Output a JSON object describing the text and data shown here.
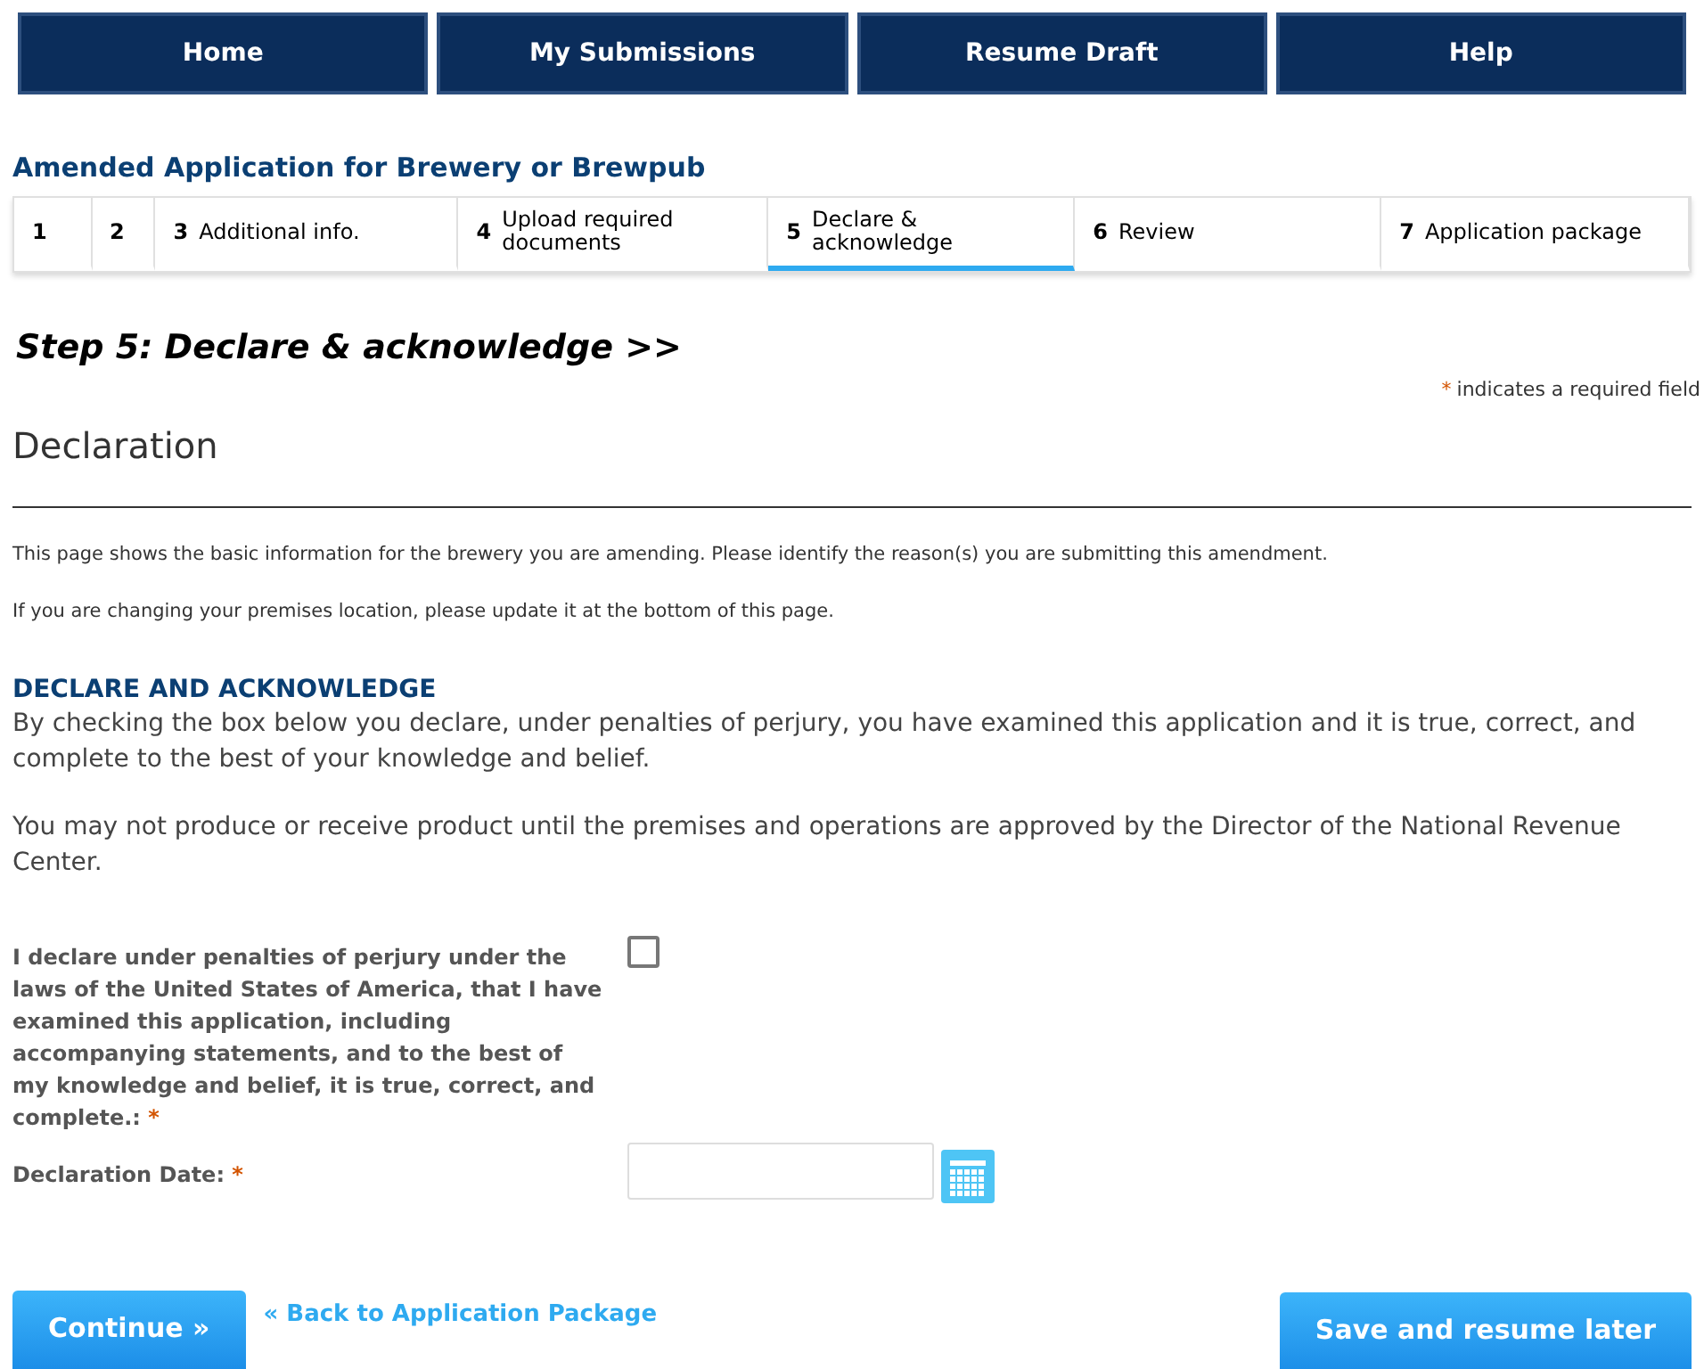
{
  "nav": [
    {
      "label": "Home"
    },
    {
      "label": "My Submissions"
    },
    {
      "label": "Resume Draft"
    },
    {
      "label": "Help"
    }
  ],
  "title": "Amended Application for Brewery or Brewpub",
  "steps": [
    {
      "number": "1",
      "selected": false
    },
    {
      "number": "2",
      "selected": false
    },
    {
      "number": "3",
      "label": "Additional info.",
      "selected": false
    },
    {
      "number": "4",
      "label": "Upload required documents",
      "selected": false
    },
    {
      "number": "5",
      "label": "Declare & acknowledge",
      "selected": true
    },
    {
      "number": "6",
      "label": "Review",
      "selected": false
    },
    {
      "number": "7",
      "label": "Application package",
      "selected": false
    }
  ],
  "step_heading": "Step 5: Declare & acknowledge >>",
  "required_note": {
    "mark": "*",
    "text": "indicates a required field"
  },
  "section_title": "Declaration",
  "intro": [
    "This page shows the basic information for the brewery you are amending. Please identify the reason(s) you are submitting this amendment.",
    "If you are changing your premises location, please update it at the bottom of this page."
  ],
  "declare_heading": "DECLARE AND ACKNOWLEDGE",
  "paragraphs": [
    "By checking the box below you declare, under penalties of perjury, you have examined this application and it is true, correct, and complete to the best of your knowledge and belief.",
    "You may not produce or receive product until the premises and operations are approved by the Director of the National Revenue Center."
  ],
  "fields": [
    {
      "kind": "checkbox",
      "label": "I declare under penalties of perjury under the laws of the United States of America, that I have examined this application, including accompanying statements, and to the best of my knowledge and belief, it is true, correct, and complete.:",
      "required_mark": "*",
      "checked": false
    },
    {
      "kind": "date",
      "label": "Declaration Date:",
      "required_mark": "*"
    }
  ],
  "buttons": {
    "continue": "Continue »",
    "back_link": "« Back to Application Package",
    "save": "Save and resume later"
  }
}
